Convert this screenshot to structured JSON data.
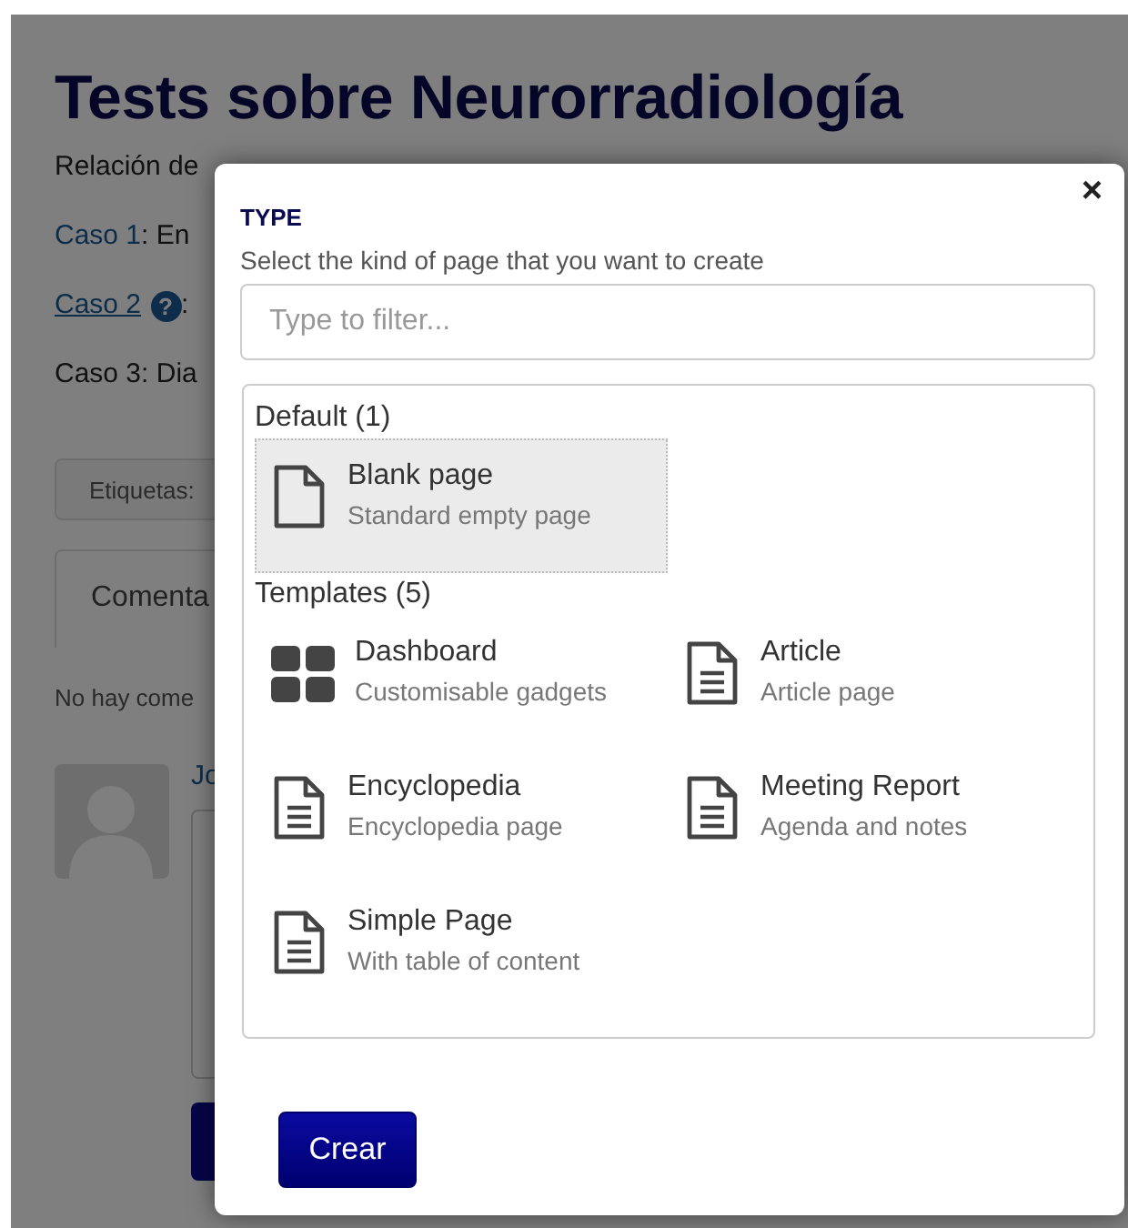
{
  "background_page": {
    "title": "Tests sobre Neurorradiología",
    "intro": "Relación de",
    "cases": [
      {
        "link": "Caso 1",
        "underlined": false,
        "rest": ": En"
      },
      {
        "link": "Caso 2",
        "underlined": true,
        "help": "?",
        "rest": ":"
      },
      {
        "rest": "Caso 3: Dia"
      }
    ],
    "tags_label": "Etiquetas:",
    "comments_tab": "Comenta",
    "no_comments": "No hay come",
    "author_link": "Jo"
  },
  "modal": {
    "close": "×",
    "heading": "TYPE",
    "subtitle": "Select the kind of page that you want to create",
    "filter": {
      "placeholder": "Type to filter..."
    },
    "sections": [
      {
        "title": "Default (1)",
        "items": [
          {
            "kind": "blank",
            "name": "Blank page",
            "description": "Standard empty page",
            "selected": true
          }
        ]
      },
      {
        "title": "Templates (5)",
        "items": [
          {
            "kind": "dashboard",
            "name": "Dashboard",
            "description": "Customisable gadgets",
            "selected": false
          },
          {
            "kind": "text",
            "name": "Article",
            "description": "Article page",
            "selected": false
          },
          {
            "kind": "text",
            "name": "Encyclopedia",
            "description": "Encyclopedia page",
            "selected": false
          },
          {
            "kind": "text",
            "name": "Meeting Report",
            "description": "Agenda and notes",
            "selected": false
          },
          {
            "kind": "text",
            "name": "Simple Page",
            "description": "With table of content",
            "selected": false
          }
        ]
      }
    ],
    "buttons": [
      "Crear"
    ]
  }
}
